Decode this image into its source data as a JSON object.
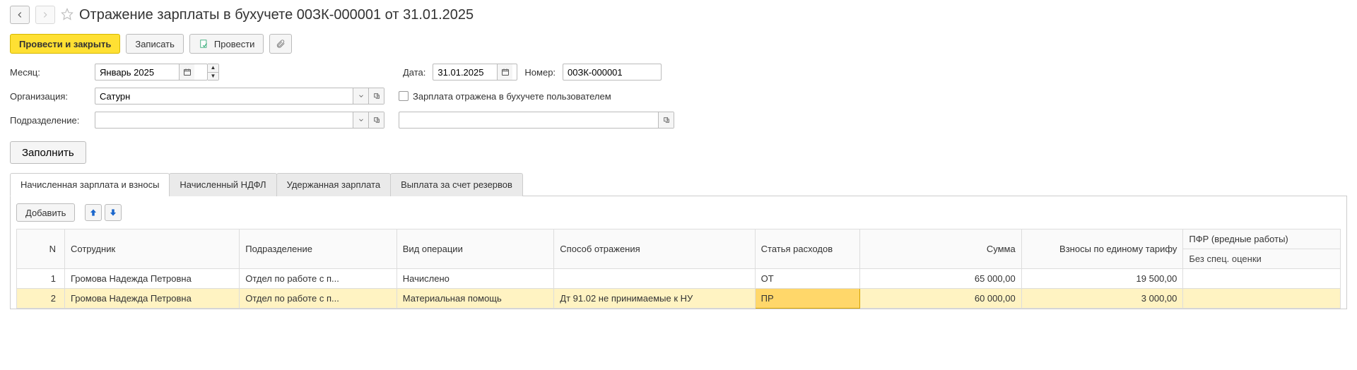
{
  "header": {
    "title": "Отражение зарплаты в бухучете 00ЗК-000001 от 31.01.2025"
  },
  "toolbar": {
    "post_close_label": "Провести и закрыть",
    "save_label": "Записать",
    "post_label": "Провести"
  },
  "form": {
    "month_label": "Месяц:",
    "month_value": "Январь 2025",
    "date_label": "Дата:",
    "date_value": "31.01.2025",
    "number_label": "Номер:",
    "number_value": "00ЗК-000001",
    "org_label": "Организация:",
    "org_value": "Сатурн",
    "checkbox_label": "Зарплата отражена в бухучете пользователем",
    "dept_label": "Подразделение:",
    "dept_value": "",
    "extra_value": ""
  },
  "fill_button_label": "Заполнить",
  "tabs": [
    {
      "label": "Начисленная зарплата и взносы",
      "active": true
    },
    {
      "label": "Начисленный НДФЛ",
      "active": false
    },
    {
      "label": "Удержанная зарплата",
      "active": false
    },
    {
      "label": "Выплата за счет резервов",
      "active": false
    }
  ],
  "tab_toolbar": {
    "add_label": "Добавить"
  },
  "grid": {
    "headers": {
      "n": "N",
      "employee": "Сотрудник",
      "department": "Подразделение",
      "op_type": "Вид операции",
      "reflection": "Способ отражения",
      "expense_item": "Статья расходов",
      "amount": "Сумма",
      "contribs": "Взносы по единому тарифу",
      "pfr": "ПФР (вредные работы)",
      "pfr_sub": "Без спец. оценки"
    },
    "rows": [
      {
        "n": "1",
        "employee": "Громова Надежда Петровна",
        "department": "Отдел по работе с п...",
        "op_type": "Начислено",
        "reflection": "",
        "expense_item": "ОТ",
        "amount": "65 000,00",
        "contribs": "19 500,00",
        "pfr": "",
        "selected": false
      },
      {
        "n": "2",
        "employee": "Громова Надежда Петровна",
        "department": "Отдел по работе с п...",
        "op_type": "Материальная помощь",
        "reflection": "Дт 91.02 не принимаемые к НУ",
        "expense_item": "ПР",
        "amount": "60 000,00",
        "contribs": "3 000,00",
        "pfr": "",
        "selected": true
      }
    ]
  }
}
